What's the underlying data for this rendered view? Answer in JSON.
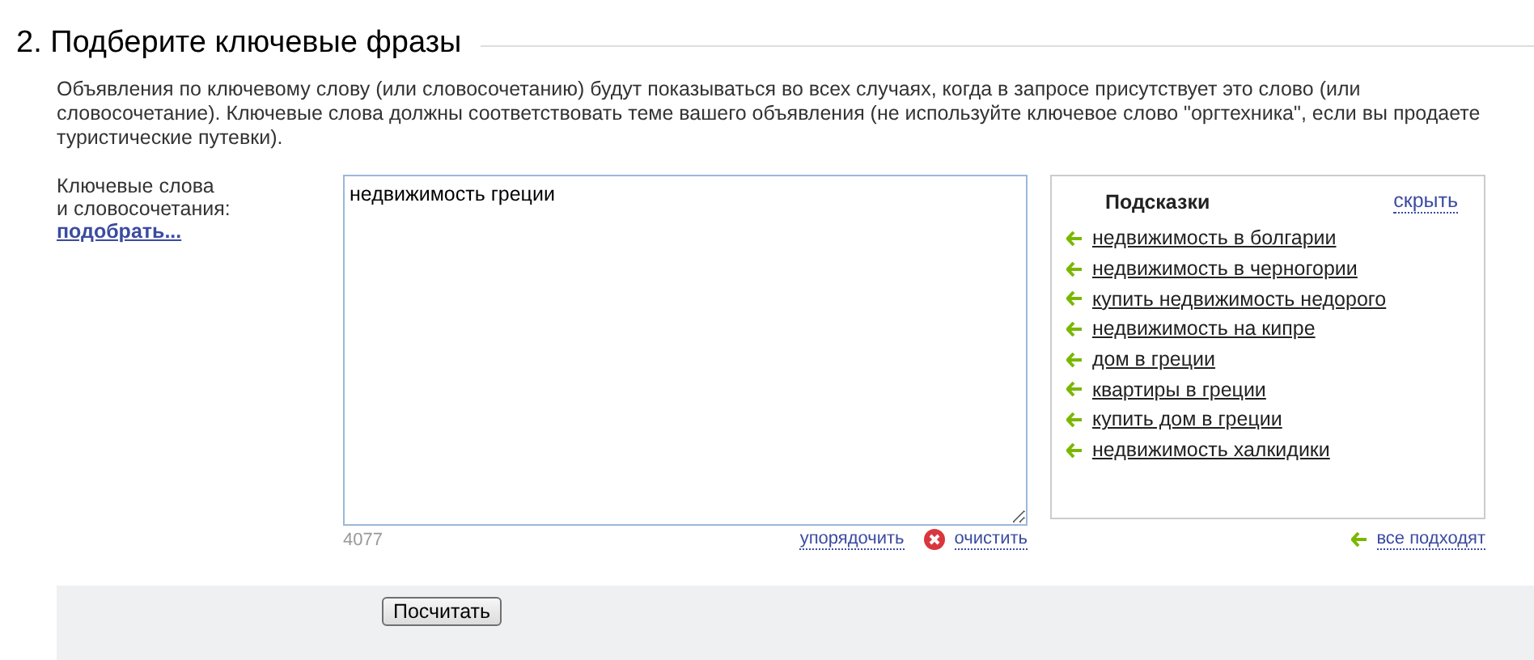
{
  "heading": "2. Подберите ключевые фразы",
  "description": "Объявления по ключевому слову (или словосочетанию) будут показываться во всех случаях, когда в запросе присутствует это слово (или словосочетание). Ключевые слова должны соответствовать теме вашего объявления (не используйте ключевое слово \"оргтехника\", если вы продаете туристические путевки).",
  "keywords": {
    "label_lines": [
      "Ключевые слова",
      "и словосочетания:"
    ],
    "pick_link": "подобрать...",
    "value": "недвижимость греции",
    "counter": "4077",
    "sort_link": "упорядочить",
    "clear_link": "очистить"
  },
  "hints": {
    "title": "Подсказки",
    "hide_link": "скрыть",
    "all_link": "все подходят",
    "items": [
      "недвижимость в болгарии",
      "недвижимость в черногории",
      "купить недвижимость недорого",
      "недвижимость на кипре",
      "дом в греции",
      "квартиры в греции",
      "купить дом в греции",
      "недвижимость халкидики"
    ]
  },
  "footer": {
    "button": "Посчитать"
  }
}
